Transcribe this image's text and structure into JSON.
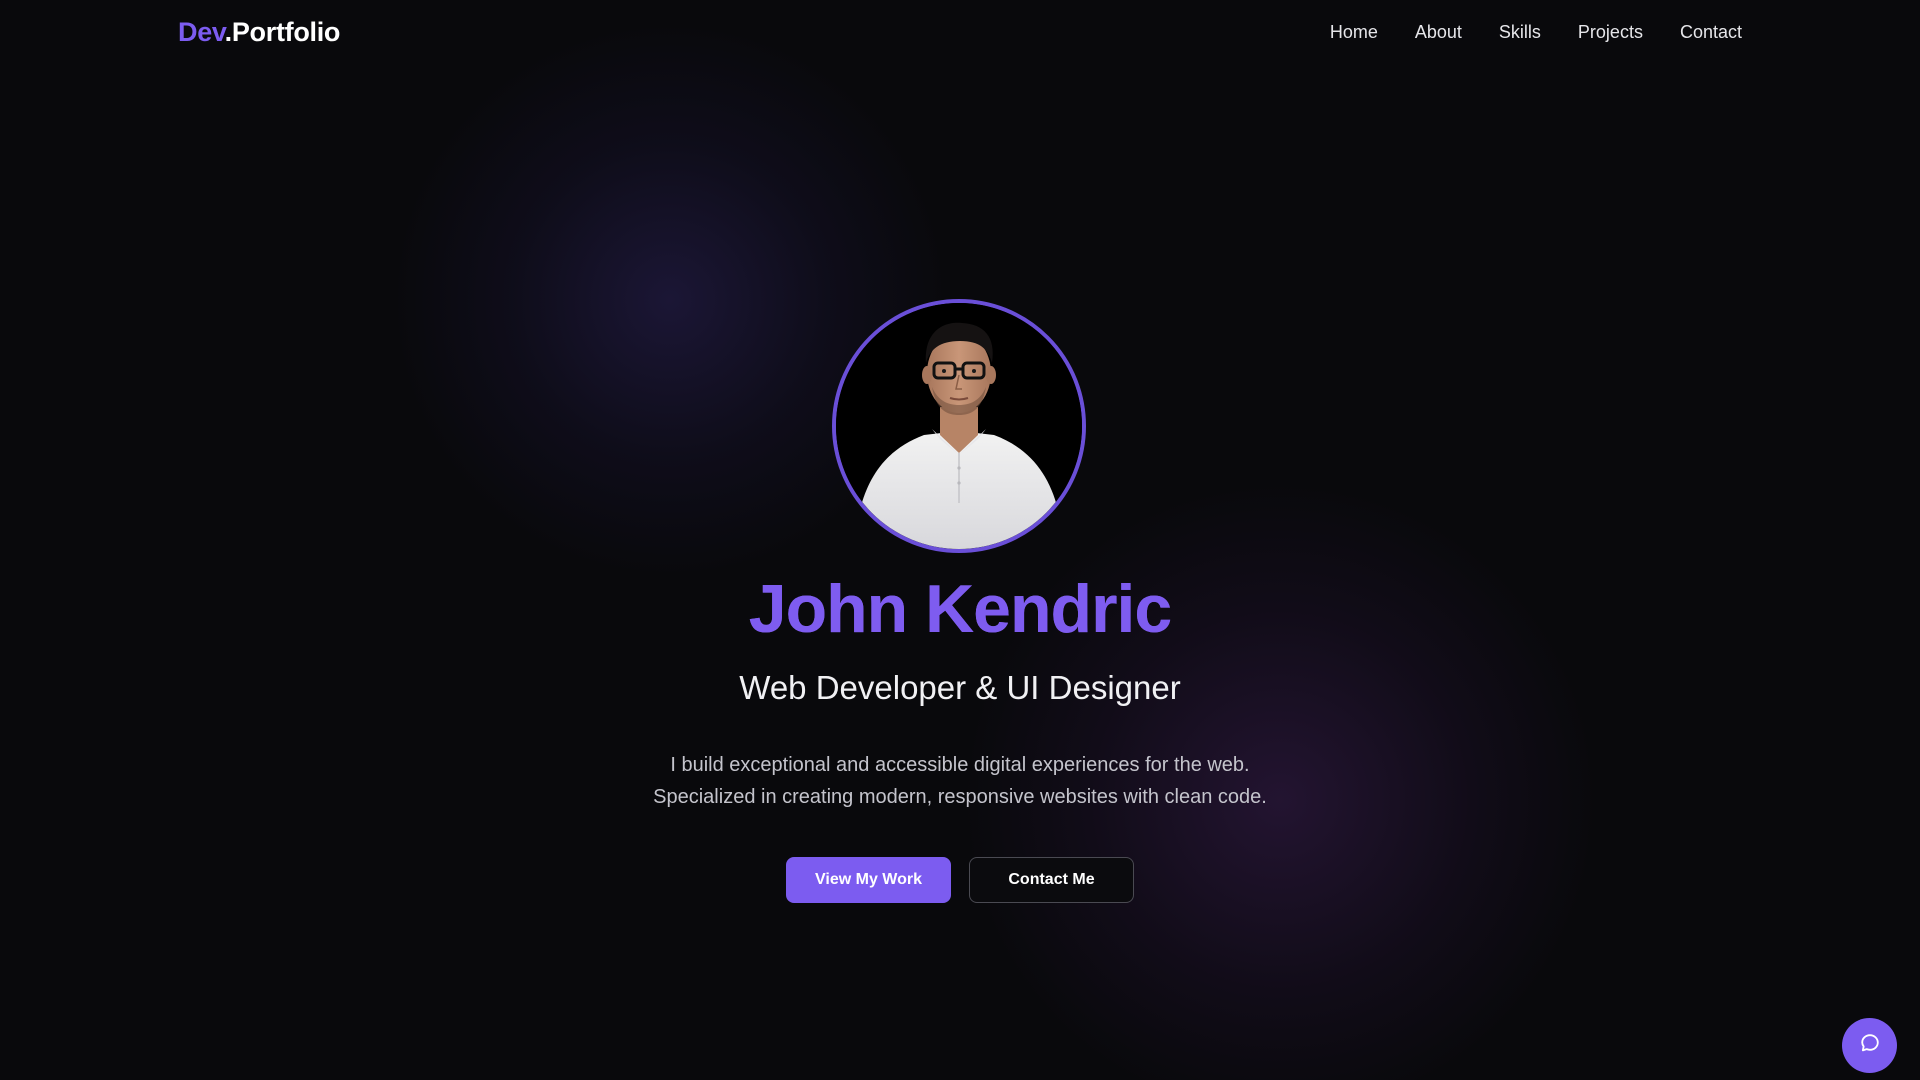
{
  "brand": {
    "prefix": "Dev",
    "suffix": ".Portfolio",
    "accent_color": "#7c5cf0"
  },
  "nav": {
    "items": [
      {
        "label": "Home"
      },
      {
        "label": "About"
      },
      {
        "label": "Skills"
      },
      {
        "label": "Projects"
      },
      {
        "label": "Contact"
      }
    ]
  },
  "hero": {
    "avatar_alt": "Portrait of a man with glasses wearing a white shirt",
    "name": "John Kendric",
    "role": "Web Developer & UI Designer",
    "description_lines": [
      "I build exceptional and accessible digital experiences for the web.",
      "Specialized in creating modern, responsive websites with clean code."
    ],
    "primary_button": "View My Work",
    "secondary_button": "Contact Me"
  },
  "chat": {
    "icon": "chat-bubble-icon"
  },
  "colors": {
    "background": "#09090c",
    "accent": "#7c5cf0",
    "avatar_ring": "#6a4fd8"
  }
}
